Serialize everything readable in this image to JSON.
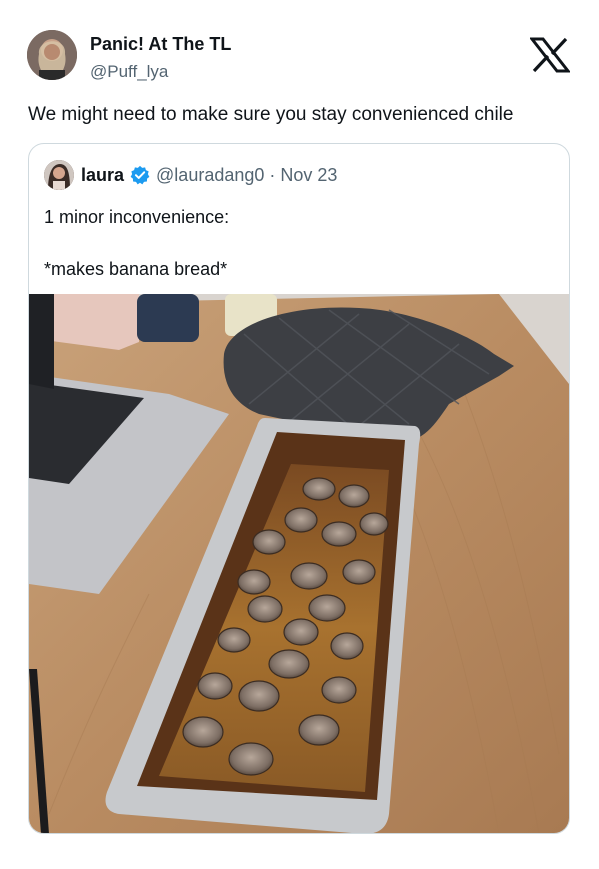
{
  "tweet": {
    "author_name": "Panic! At The TL",
    "author_handle": "@Puff_lya",
    "text": "We might need to make sure you stay convenienced chile"
  },
  "quoted_tweet": {
    "author_name": "laura",
    "author_handle": "@lauradang0",
    "separator": "·",
    "date": "Nov 23",
    "text_line1": "1 minor inconvenience:",
    "text_line2": "*makes banana bread*",
    "verified": true
  },
  "icons": {
    "brand": "x-logo-icon",
    "verified": "verified-badge-icon",
    "verified_color": "#1d9bf0"
  }
}
